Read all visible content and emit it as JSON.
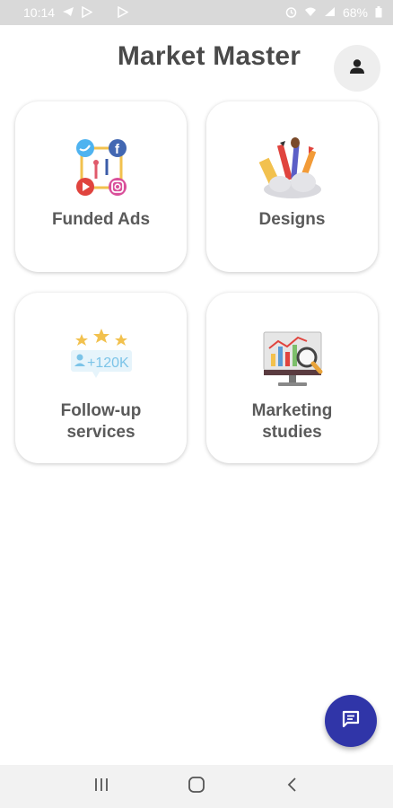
{
  "status_bar": {
    "time": "10:14",
    "battery": "68%",
    "left_icons": [
      "telegram-icon",
      "play-store-icon",
      "play-store-icon"
    ],
    "right_icons": [
      "alarm-icon",
      "wifi-icon",
      "signal-icon",
      "battery-icon"
    ]
  },
  "header": {
    "title": "Market Master",
    "profile_icon": "person-icon"
  },
  "cards": [
    {
      "label": "Funded Ads",
      "icon": "social-media-icon"
    },
    {
      "label": "Designs",
      "icon": "design-tools-icon"
    },
    {
      "label_line1": "Follow-up",
      "label_line2": "services",
      "icon": "followers-icon",
      "badge_text": "+120K"
    },
    {
      "label_line1": "Marketing",
      "label_line2": "studies",
      "icon": "analytics-monitor-icon"
    }
  ],
  "fab": {
    "icon": "chat-icon"
  },
  "nav_bar": {
    "buttons": [
      "recent-apps-icon",
      "home-icon",
      "back-icon"
    ]
  },
  "colors": {
    "accent": "#3035a8",
    "title": "#4a4a4a",
    "status_bar": "#d9d9d9"
  }
}
